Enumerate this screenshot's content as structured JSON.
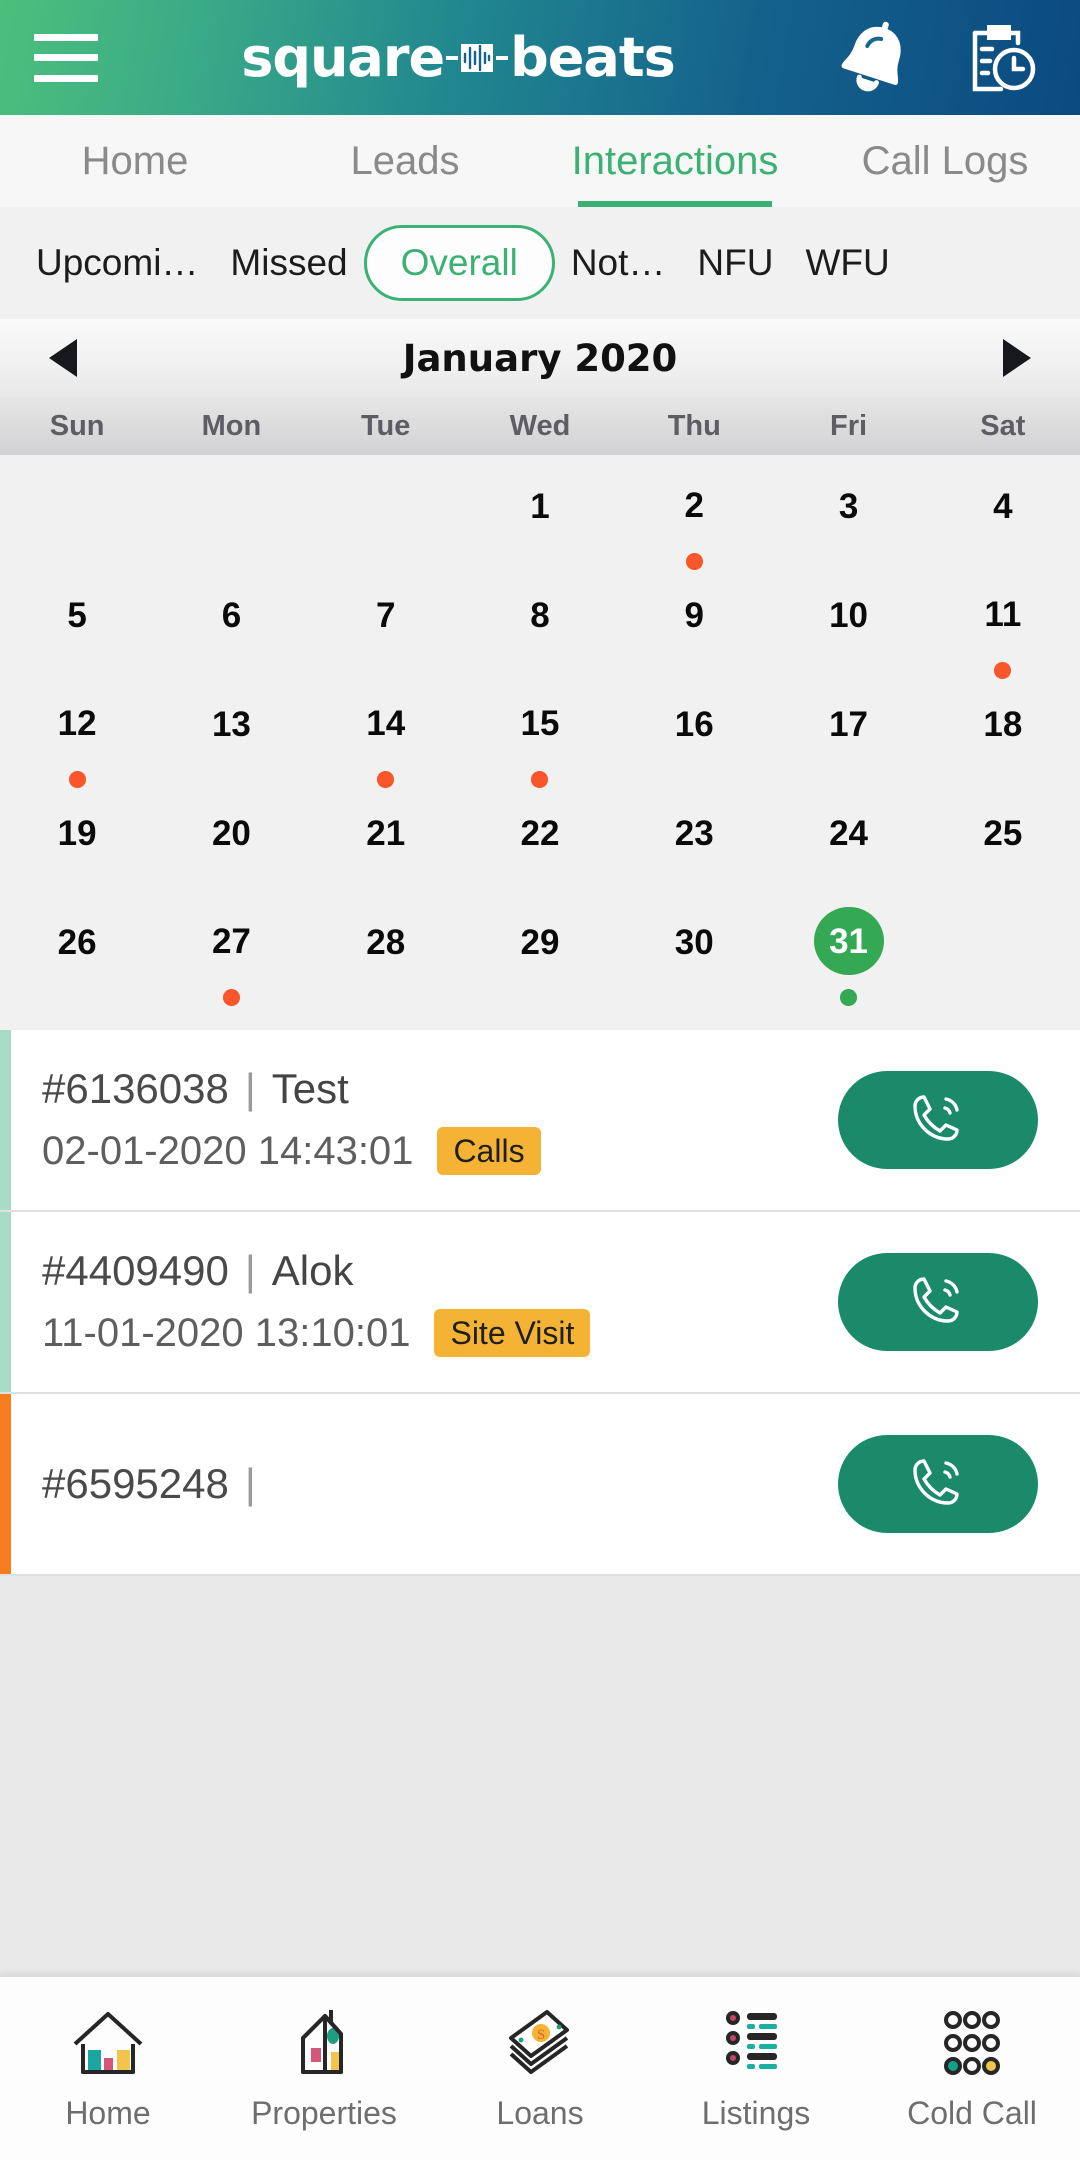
{
  "header": {
    "menu_icon": "hamburger-menu-icon",
    "brand_left": "square",
    "brand_right": "beats",
    "brand_wave_icon": "audio-waveform-icon",
    "notification_icon": "bell-icon",
    "tasks_icon": "clipboard-clock-icon"
  },
  "tabs": [
    {
      "label": "Home",
      "active": false
    },
    {
      "label": "Leads",
      "active": false
    },
    {
      "label": "Interactions",
      "active": true
    },
    {
      "label": "Call Logs",
      "active": false
    }
  ],
  "filters": [
    {
      "label": "Upcomi…",
      "selected": false
    },
    {
      "label": "Missed",
      "selected": false
    },
    {
      "label": "Overall",
      "selected": true
    },
    {
      "label": "Not…",
      "selected": false
    },
    {
      "label": "NFU",
      "selected": false
    },
    {
      "label": "WFU",
      "selected": false
    }
  ],
  "calendar": {
    "prev_icon": "chevron-left-icon",
    "next_icon": "chevron-right-icon",
    "title": "January 2020",
    "weekdays": [
      "Sun",
      "Mon",
      "Tue",
      "Wed",
      "Thu",
      "Fri",
      "Sat"
    ],
    "selected_day": 31,
    "marked_days": [
      2,
      11,
      12,
      14,
      15,
      27
    ],
    "weeks": [
      [
        null,
        null,
        null,
        1,
        2,
        3,
        4
      ],
      [
        5,
        6,
        7,
        8,
        9,
        10,
        11
      ],
      [
        12,
        13,
        14,
        15,
        16,
        17,
        18
      ],
      [
        19,
        20,
        21,
        22,
        23,
        24,
        25
      ],
      [
        26,
        27,
        28,
        29,
        30,
        31,
        null
      ]
    ]
  },
  "interactions": [
    {
      "id": "#6136038",
      "separator": "|",
      "name": "Test",
      "datetime": "02-01-2020 14:43:01",
      "badge": "Calls",
      "accent": "green",
      "call_icon": "phone-call-icon"
    },
    {
      "id": "#4409490",
      "separator": "|",
      "name": "Alok",
      "datetime": "11-01-2020 13:10:01",
      "badge": "Site Visit",
      "accent": "green",
      "call_icon": "phone-call-icon"
    },
    {
      "id": "#6595248",
      "separator": "|",
      "name": "",
      "datetime": "",
      "badge": "",
      "accent": "orange",
      "call_icon": "phone-call-icon"
    }
  ],
  "bottom_nav": [
    {
      "label": "Home",
      "icon": "house-icon"
    },
    {
      "label": "Properties",
      "icon": "building-icon"
    },
    {
      "label": "Loans",
      "icon": "money-stack-icon"
    },
    {
      "label": "Listings",
      "icon": "bullet-list-icon"
    },
    {
      "label": "Cold Call",
      "icon": "dial-pad-icon"
    }
  ],
  "colors": {
    "brand_green": "#3bb273",
    "header_gradient_start": "#4cbf7c",
    "header_gradient_end": "#0b4a80",
    "selected_day": "#34a853",
    "marker_dot": "#f9562b",
    "badge": "#f5b335",
    "call_button": "#1a8a6a",
    "accent_orange": "#f57c1f"
  }
}
